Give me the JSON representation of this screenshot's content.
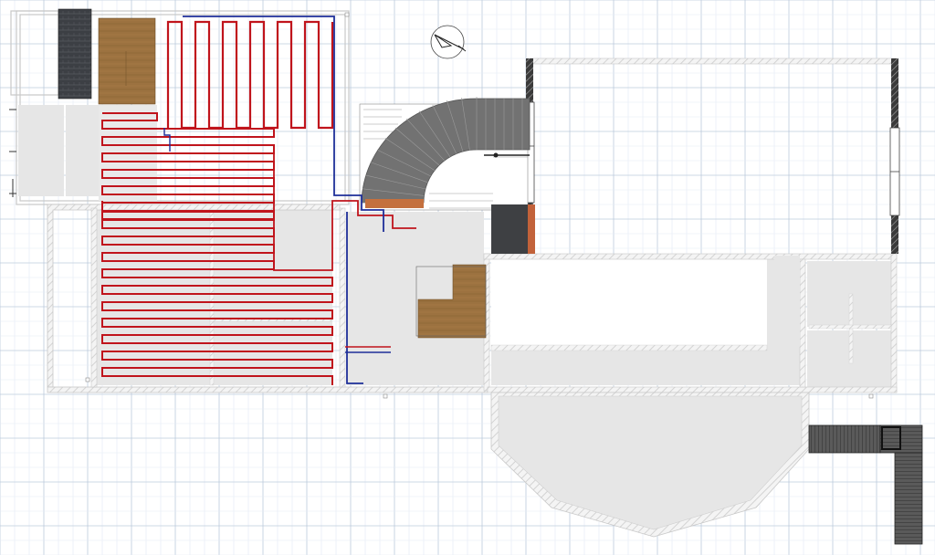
{
  "colors": {
    "background": "#ffffff",
    "grid_minor": "#e3eaf3",
    "grid_major": "#bccbdc",
    "wall_outline": "#c8c8c8",
    "wall_hatch": "#dcdcdc",
    "floor_fill": "#e6e6e6",
    "heating_supply": "#c0141c",
    "heating_return": "#1e2f99",
    "wood_floor": "#9c7240",
    "roof_tile": "#3c3f44",
    "stone_stair": "#6d6d6d",
    "brick": "#c2623a",
    "deck_dark": "#4a4a4a"
  },
  "icons": {
    "north_arrow": "compass-north-arrow-icon"
  }
}
